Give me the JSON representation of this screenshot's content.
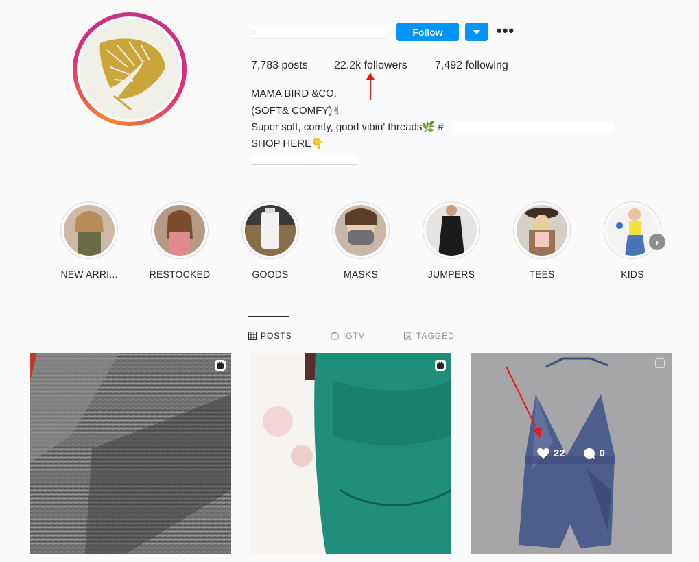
{
  "profile": {
    "follow_label": "Follow",
    "stats": {
      "posts": "7,783 posts",
      "followers": "22.2k followers",
      "following": "7,492 following"
    },
    "bio": {
      "name": "MAMA BIRD &CO.",
      "line1": "(SOFT& COMFY)✌",
      "line2": "Super soft, comfy, good vibin' threads🌿",
      "line2_tag": "#",
      "line3": "SHOP HERE👇"
    }
  },
  "highlights": [
    {
      "label": "NEW ARRI..."
    },
    {
      "label": "RESTOCKED"
    },
    {
      "label": "GOODS"
    },
    {
      "label": "MASKS"
    },
    {
      "label": "JUMPERS"
    },
    {
      "label": "TEES"
    },
    {
      "label": "KIDS"
    }
  ],
  "tabs": [
    {
      "label": "POSTS",
      "active": true
    },
    {
      "label": "IGTV",
      "active": false
    },
    {
      "label": "TAGGED",
      "active": false
    }
  ],
  "posts": [
    {
      "type": "igtv"
    },
    {
      "type": "igtv"
    },
    {
      "type": "photo",
      "likes": "22",
      "comments": "0"
    }
  ],
  "colors": {
    "accent": "#0095f6",
    "annotation": "#e8191a"
  },
  "icons": [
    "chevron-down-icon",
    "more-icon",
    "grid-icon",
    "igtv-icon",
    "tagged-icon",
    "heart-icon",
    "comment-icon",
    "chevron-right-icon",
    "igtv-badge-icon"
  ]
}
